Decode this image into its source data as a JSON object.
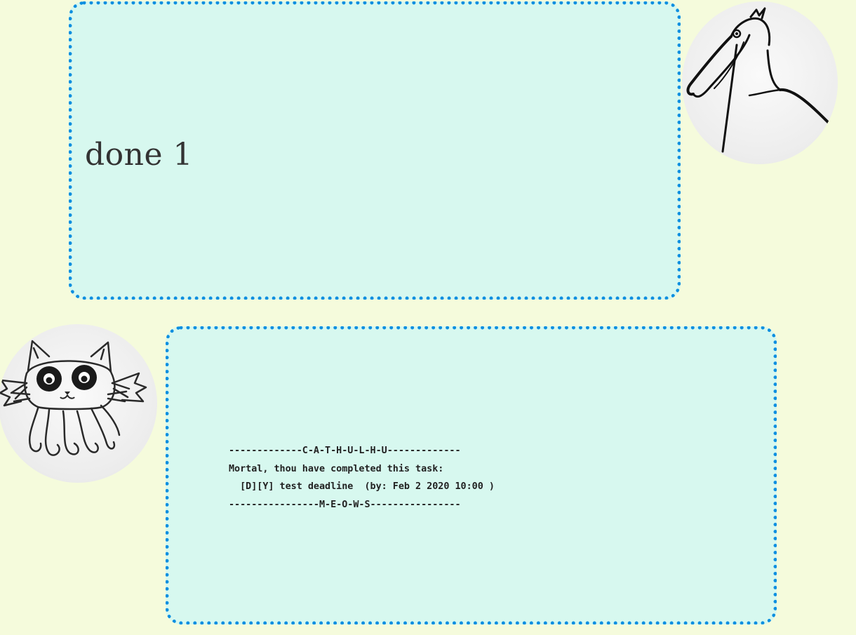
{
  "user_message": {
    "text": "done 1"
  },
  "bot_message": {
    "lines": [
      "-------------C-A-T-H-U-L-H-U-------------",
      "Mortal, thou have completed this task:",
      "  [D][Y] test deadline  (by: Feb 2 2020 10:00 )",
      "----------------M-E-O-W-S----------------"
    ]
  },
  "avatars": {
    "user": "shoebill-bird-drawing",
    "bot": "cathulhu-cat-drawing"
  },
  "colors": {
    "background": "#f5fbdc",
    "bubble_fill": "#d7f8ef",
    "bubble_border": "#0d8fe0"
  }
}
